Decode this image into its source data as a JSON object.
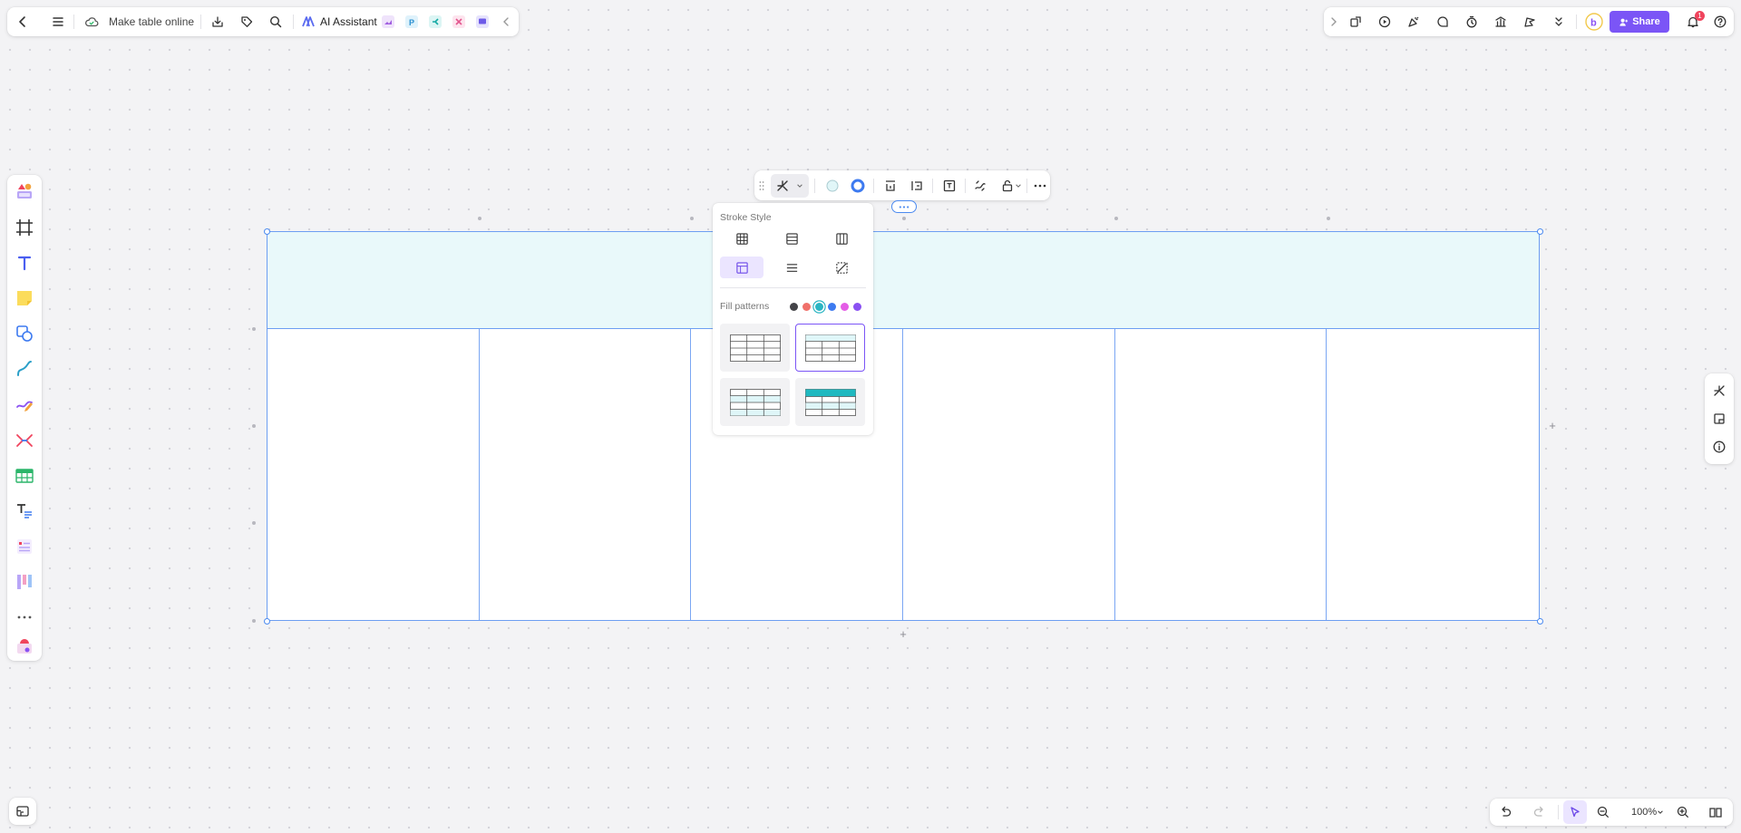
{
  "header": {
    "doc_title": "Make table online",
    "ai_assistant_label": "AI Assistant"
  },
  "topright": {
    "share_label": "Share",
    "notification_count": "1"
  },
  "zoom": {
    "value": "100%"
  },
  "popup": {
    "stroke_title": "Stroke Style",
    "fill_title": "Fill patterns",
    "stroke_options": [
      "all-borders-icon",
      "horizontal-borders-icon",
      "vertical-borders-icon",
      "header-borders-icon",
      "inner-horizontal-icon",
      "no-border-icon"
    ],
    "selected_stroke": "header-borders-icon",
    "fill_colors": [
      "#444448",
      "#f0706a",
      "#2bb5c3",
      "#3d7af0",
      "#e45de6",
      "#8a51f2"
    ],
    "selected_color": "#2bb5c3",
    "fill_patterns": [
      "plain-pattern",
      "header-pattern",
      "banded-rows-pattern",
      "filled-header-pattern"
    ],
    "selected_pattern": "header-pattern"
  },
  "colors": {
    "accent": "#7b55f6",
    "selection": "#4b8af0",
    "table_header_fill": "#e9f9fa"
  }
}
